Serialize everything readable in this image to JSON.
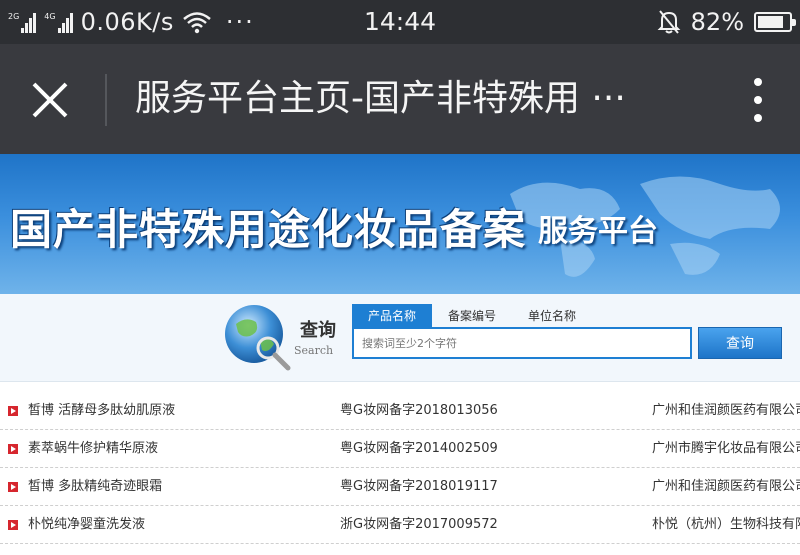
{
  "status_bar": {
    "signal1_tag": "2G",
    "signal2_tag": "4G",
    "net_speed": "0.06K/s",
    "more": "···",
    "time": "14:44",
    "battery_pct": "82%",
    "battery_level": 0.82,
    "icons": [
      "signal-icon",
      "wifi-icon",
      "bell-muted-icon",
      "battery-icon"
    ]
  },
  "app_bar": {
    "title": "服务平台主页-国产非特殊用 ···",
    "icons": [
      "close-icon",
      "more-vertical-icon"
    ]
  },
  "banner": {
    "title": "国产非特殊用途化妆品备案",
    "subtitle": "服务平台"
  },
  "search": {
    "label": "查询",
    "label_en": "Search",
    "tabs": [
      {
        "label": "产品名称",
        "active": true
      },
      {
        "label": "备案编号",
        "active": false
      },
      {
        "label": "单位名称",
        "active": false
      }
    ],
    "placeholder": "搜索词至少2个字符",
    "button": "查询"
  },
  "records": [
    {
      "name": "皙博 活酵母多肽幼肌原液",
      "code": "粤G妆网备字2018013056",
      "company": "广州和佳润颜医药有限公司"
    },
    {
      "name": "素萃蜗牛修护精华原液",
      "code": "粤G妆网备字2014002509",
      "company": "广州市腾宇化妆品有限公司"
    },
    {
      "name": "皙博 多肽精纯奇迹眼霜",
      "code": "粤G妆网备字2018019117",
      "company": "广州和佳润颜医药有限公司"
    },
    {
      "name": "朴悦纯净婴童洗发液",
      "code": "浙G妆网备字2017009572",
      "company": "朴悦（杭州）生物科技有限公司"
    }
  ],
  "colors": {
    "status_bar_bg": "#2d2f33",
    "app_bar_bg": "#393a3f",
    "accent_blue": "#1e7fd3",
    "bullet_red": "#d6262e"
  }
}
